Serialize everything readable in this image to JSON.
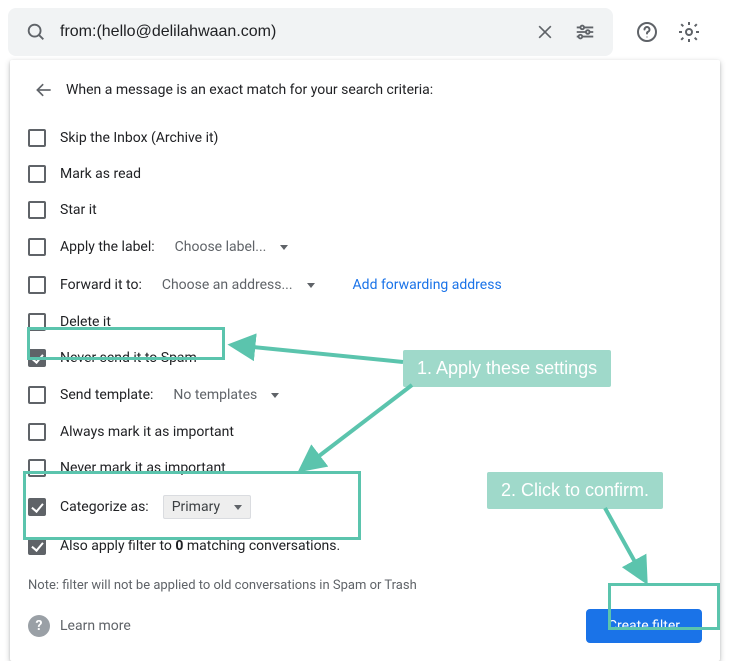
{
  "search": {
    "value": "from:(hello@delilahwaan.com)"
  },
  "panel": {
    "heading": "When a message is an exact match for your search criteria:",
    "note": "Note: filter will not be applied to old conversations in Spam or Trash",
    "learn_more": "Learn more",
    "create_filter": "Create filter"
  },
  "opts": {
    "skip_inbox": "Skip the Inbox (Archive it)",
    "mark_read": "Mark as read",
    "star": "Star it",
    "apply_label_prefix": "Apply the label:",
    "apply_label_value": "Choose label...",
    "forward_prefix": "Forward it to:",
    "forward_value": "Choose an address...",
    "forward_link": "Add forwarding address",
    "delete": "Delete it",
    "never_spam": "Never send it to Spam",
    "send_tpl_prefix": "Send template:",
    "send_tpl_value": "No templates",
    "always_important": "Always mark it as important",
    "never_important": "Never mark it as important",
    "categorize_prefix": "Categorize as:",
    "categorize_value": "Primary",
    "apply_existing_count": "0"
  },
  "ann": {
    "step1": "1. Apply these settings",
    "step2": "2. Click to confirm."
  }
}
